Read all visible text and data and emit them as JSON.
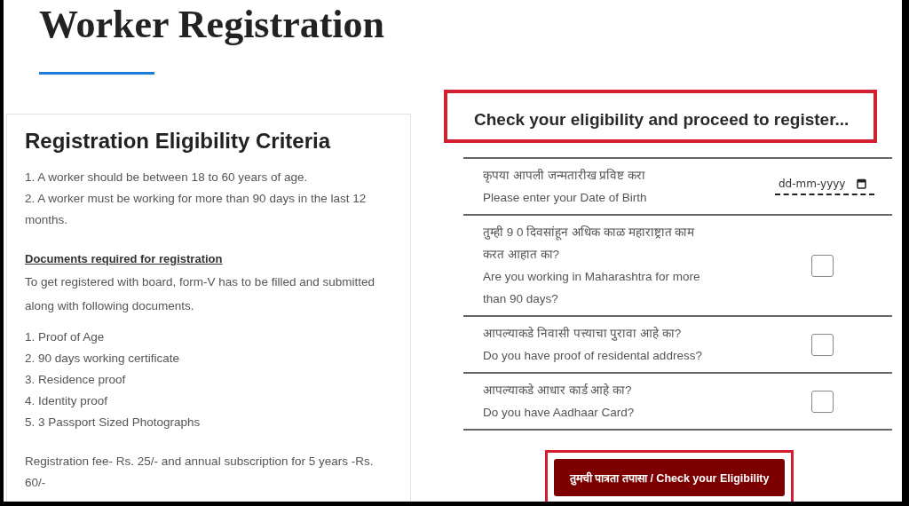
{
  "page_title": "Worker Registration",
  "criteria": {
    "heading": "Registration Eligibility Criteria",
    "rules": [
      "1. A worker should be between 18 to 60 years of age.",
      "2. A worker must be working for more than 90 days in the last 12 months."
    ],
    "documents_heading": "Documents required for registration",
    "documents_intro": "To get registered with board, form-V has to be filled and submitted along with following documents.",
    "documents": [
      "1. Proof of Age",
      "2. 90 days working certificate",
      "3. Residence proof",
      "4. Identity proof",
      "5. 3 Passport Sized Photographs"
    ],
    "fee_note": "Registration fee- Rs. 25/- and annual subscription for 5 years -Rs. 60/-"
  },
  "eligibility": {
    "heading": "Check your eligibility and proceed to register...",
    "questions": [
      {
        "kind": "date",
        "marathi": "कृपया आपली जन्मतारीख प्रविष्ट करा",
        "english": "Please enter your Date of Birth",
        "placeholder": "dd-mm-yyyy"
      },
      {
        "kind": "checkbox",
        "marathi": "तुम्ही 9 0 दिवसांहून अधिक काळ महाराष्ट्रात काम करत आहात का?",
        "english": "Are you working in Maharashtra for more than 90 days?",
        "checked": false
      },
      {
        "kind": "checkbox",
        "marathi": "आपल्याकडे निवासी पत्त्याचा पुरावा आहे का?",
        "english": "Do you have proof of residental address?",
        "checked": false
      },
      {
        "kind": "checkbox",
        "marathi": "आपल्याकडे आधार कार्ड आहे का?",
        "english": "Do you have Aadhaar Card?",
        "checked": false
      }
    ],
    "button": "तुमची पात्रता तपासा / Check your Eligibility"
  }
}
